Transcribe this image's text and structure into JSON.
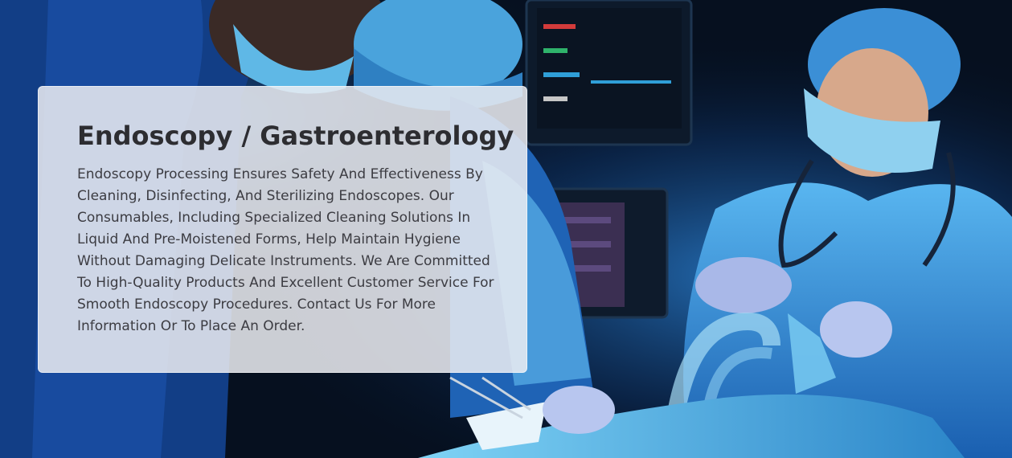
{
  "section": {
    "title": "Endoscopy / Gastroenterology",
    "description": "Endoscopy Processing Ensures Safety And Effectiveness By Cleaning, Disinfecting, And Sterilizing Endoscopes. Our Consumables, Including Specialized Cleaning Solutions In Liquid And Pre-Moistened Forms, Help Maintain Hygiene Without Damaging Delicate Instruments. We Are Committed To High-Quality Products And Excellent Customer Service For Smooth Endoscopy Procedures. Contact Us For More Information Or To Place An Order."
  },
  "colors": {
    "card_background": "#eceef2",
    "title_text": "#2d2d31",
    "body_text": "#3c3c42",
    "scene_dark": "#06101f",
    "scrubs_blue": "#2f8fd8"
  },
  "background_image": "surgical-team-operating-room-photo"
}
